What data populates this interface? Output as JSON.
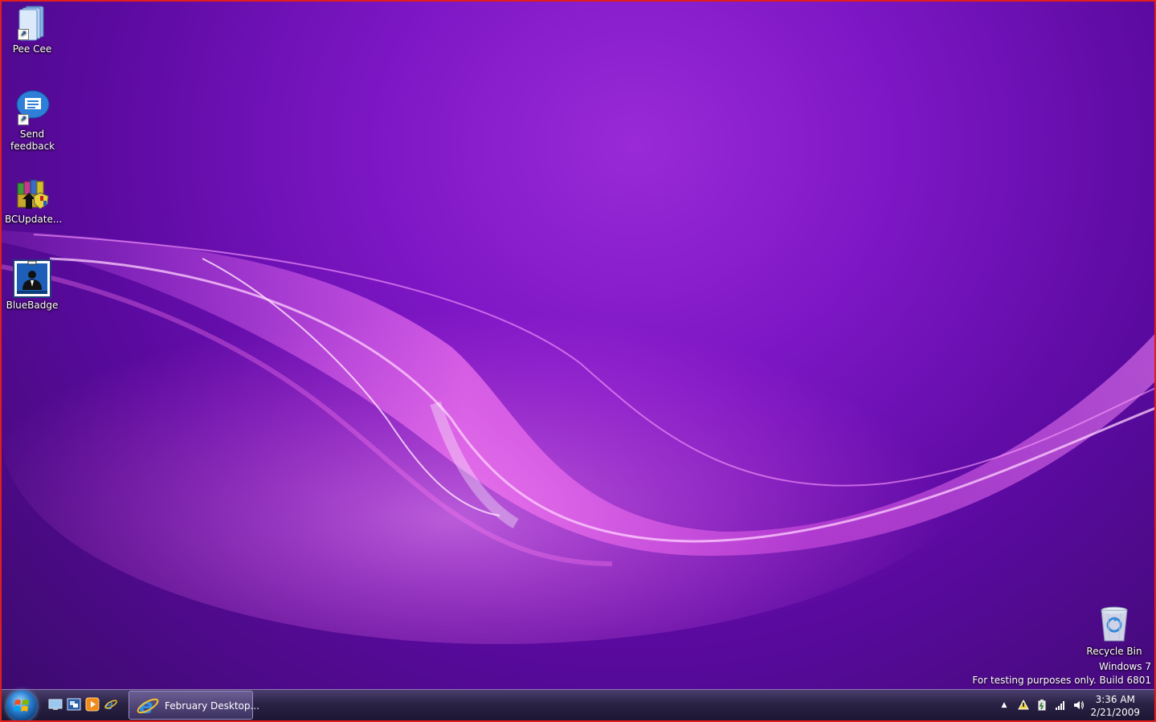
{
  "desktop": {
    "icons": [
      {
        "label": "Pee Cee"
      },
      {
        "label": "Send feedback"
      },
      {
        "label": "BCUpdate..."
      },
      {
        "label": "BlueBadge"
      }
    ],
    "recycle_bin": {
      "label": "Recycle Bin"
    },
    "watermark": {
      "line1": "Windows 7",
      "line2": "For testing purposes only. Build 6801"
    }
  },
  "taskbar": {
    "task_button_label": "February Desktop...",
    "quick_launch": [
      "show-desktop-icon",
      "switch-windows-icon",
      "media-player-icon",
      "internet-explorer-icon"
    ],
    "tray": {
      "time": "3:36 AM",
      "date": "2/21/2009",
      "overflow_glyph": "▲",
      "icons": [
        "action-center-icon",
        "power-icon",
        "network-signal-icon",
        "volume-icon"
      ]
    }
  },
  "colors": {
    "border": "#e01e1e",
    "wallpaper_base": "#7c16c4",
    "wave": "#ff7bf5"
  }
}
